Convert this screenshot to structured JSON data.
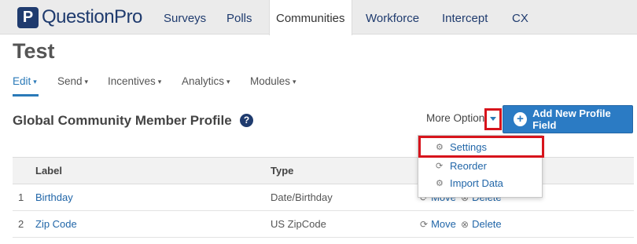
{
  "brand": {
    "mark": "P",
    "name": "QuestionPro"
  },
  "nav": {
    "tabs": [
      "Surveys",
      "Polls",
      "Communities",
      "Workforce",
      "Intercept",
      "CX"
    ],
    "active": "Communities"
  },
  "page": {
    "title": "Test"
  },
  "subnav": {
    "items": [
      "Edit",
      "Send",
      "Incentives",
      "Analytics",
      "Modules"
    ],
    "active": "Edit",
    "caret": "▾"
  },
  "section": {
    "title": "Global Community Member Profile",
    "help": "?"
  },
  "toolbar": {
    "more_options": "More Options",
    "add_button": "Add New Profile Field",
    "add_icon": "+"
  },
  "table": {
    "headers": {
      "label": "Label",
      "type": "Type"
    },
    "rows": [
      {
        "num": "1",
        "label": "Birthday",
        "type": "Date/Birthday",
        "move": "Move",
        "delete": "Delete"
      },
      {
        "num": "2",
        "label": "Zip Code",
        "type": "US ZipCode",
        "move": "Move",
        "delete": "Delete"
      }
    ]
  },
  "dropdown": {
    "items": [
      {
        "label": "Settings",
        "icon": "gears-icon"
      },
      {
        "label": "Reorder",
        "icon": "refresh-icon"
      },
      {
        "label": "Import Data",
        "icon": "gears-icon"
      }
    ]
  },
  "colors": {
    "brand": "#1f3b6e",
    "accent": "#2b7bc4",
    "highlight": "#d7141c"
  }
}
